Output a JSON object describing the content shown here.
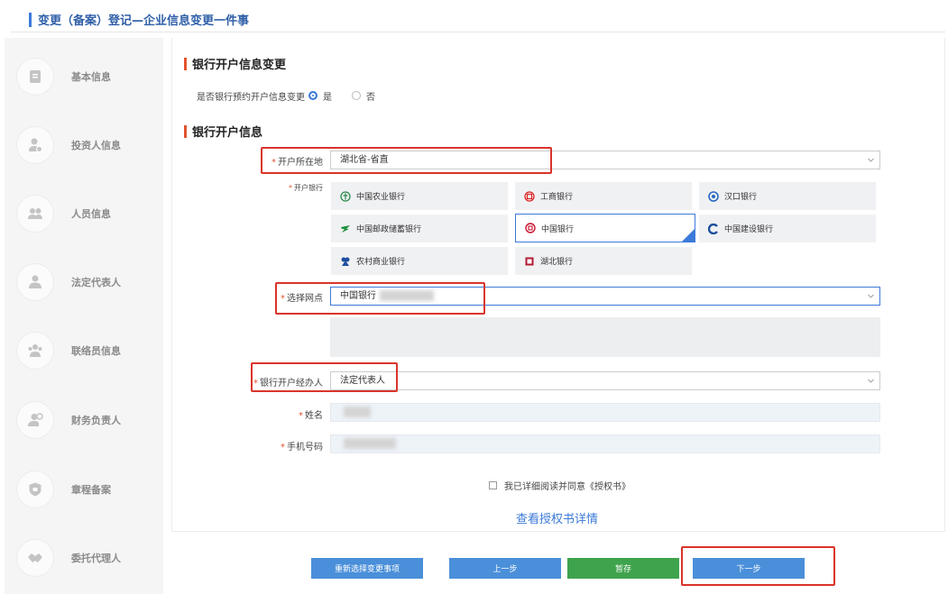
{
  "header": {
    "title": "变更（备案）登记—企业信息变更一件事"
  },
  "sidebar": {
    "items": [
      {
        "label": "基本信息",
        "icon": "document-icon"
      },
      {
        "label": "投资人信息",
        "icon": "investor-icon"
      },
      {
        "label": "人员信息",
        "icon": "people-icon"
      },
      {
        "label": "法定代表人",
        "icon": "person-icon"
      },
      {
        "label": "联络员信息",
        "icon": "contact-icon"
      },
      {
        "label": "财务负责人",
        "icon": "finance-person-icon"
      },
      {
        "label": "章程备案",
        "icon": "shield-icon"
      },
      {
        "label": "委托代理人",
        "icon": "handshake-icon"
      }
    ]
  },
  "section1": {
    "title": "银行开户信息变更",
    "question": "是否银行预约开户信息变更",
    "yes": "是",
    "no": "否"
  },
  "section2": {
    "title": "银行开户信息",
    "location": {
      "label": "开户所在地",
      "value": "湖北省-省直"
    },
    "bank": {
      "label": "开户银行"
    },
    "banks": [
      {
        "name": "中国农业银行"
      },
      {
        "name": "工商银行"
      },
      {
        "name": "汉口银行"
      },
      {
        "name": "中国邮政储蓄银行"
      },
      {
        "name": "中国银行"
      },
      {
        "name": "中国建设银行"
      },
      {
        "name": "农村商业银行"
      },
      {
        "name": "湖北银行"
      }
    ],
    "selected_bank": "中国银行",
    "branch": {
      "label": "选择网点",
      "value": "中国银行"
    },
    "handler": {
      "label": "银行开户经办人",
      "value": "法定代表人"
    },
    "name": {
      "label": "姓名"
    },
    "phone": {
      "label": "手机号码"
    }
  },
  "agree_text": "我已详细阅读并同意《授权书》",
  "view_link": "查看授权书详情",
  "buttons": {
    "reselect": "重新选择变更事项",
    "prev": "上一步",
    "save": "暂存",
    "next": "下一步"
  },
  "colors": {
    "accent": "#3b7ad9",
    "section_mark": "#e2532d",
    "save_green": "#3fa34d",
    "highlight_red": "#d9342b"
  }
}
